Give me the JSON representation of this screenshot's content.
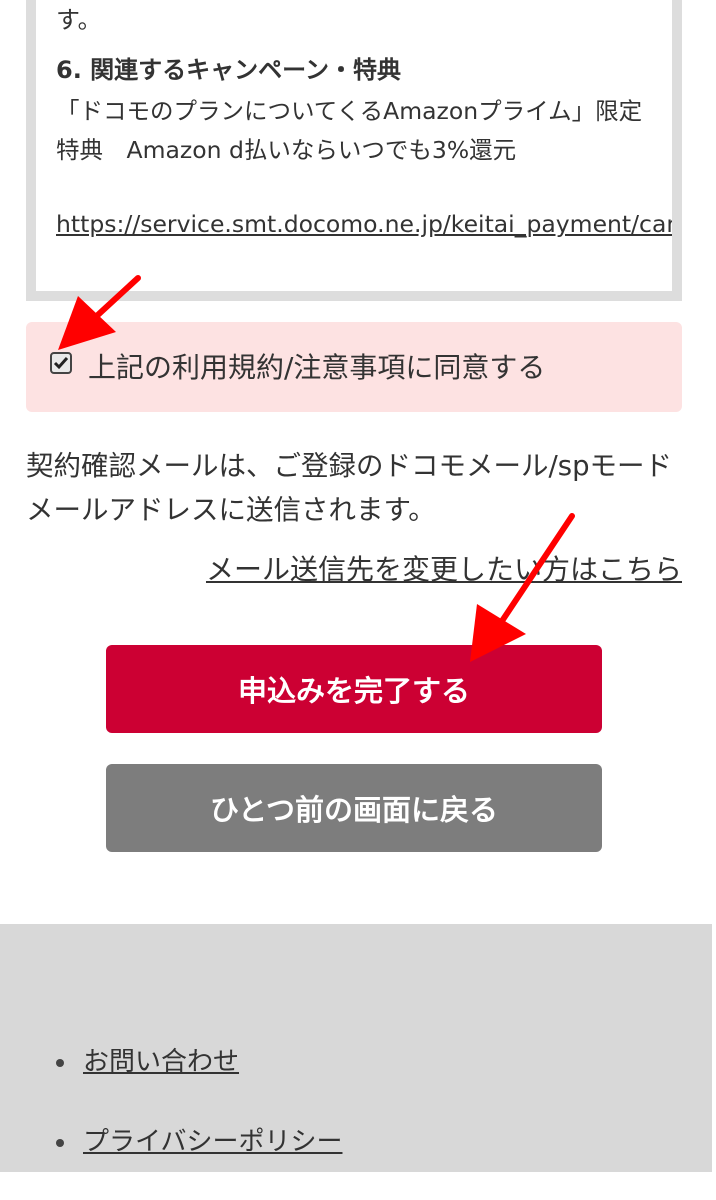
{
  "terms": {
    "tail_text": "す。",
    "heading": "6. 関連するキャンペーン・特典",
    "body": "「ドコモのプランについてくるAmazonプライム」限定特典　Amazon d払いならいつでも3%還元",
    "link": "https://service.smt.docomo.ne.jp/keitai_payment/cam"
  },
  "agree": {
    "checked": true,
    "label": "上記の利用規約/注意事項に同意する"
  },
  "mail_note": "契約確認メールは、ご登録のドコモメール/spモードメールアドレスに送信されます。",
  "mail_change_link": "メール送信先を変更したい方はこちら",
  "buttons": {
    "submit": "申込みを完了する",
    "back": "ひとつ前の画面に戻る"
  },
  "footer": {
    "links": [
      "お問い合わせ",
      "プライバシーポリシー"
    ]
  },
  "colors": {
    "submit_bg": "#cc0033",
    "back_bg": "#7d7d7d",
    "agree_bg": "#fde2e2",
    "annotation_arrow": "#ff0000"
  }
}
